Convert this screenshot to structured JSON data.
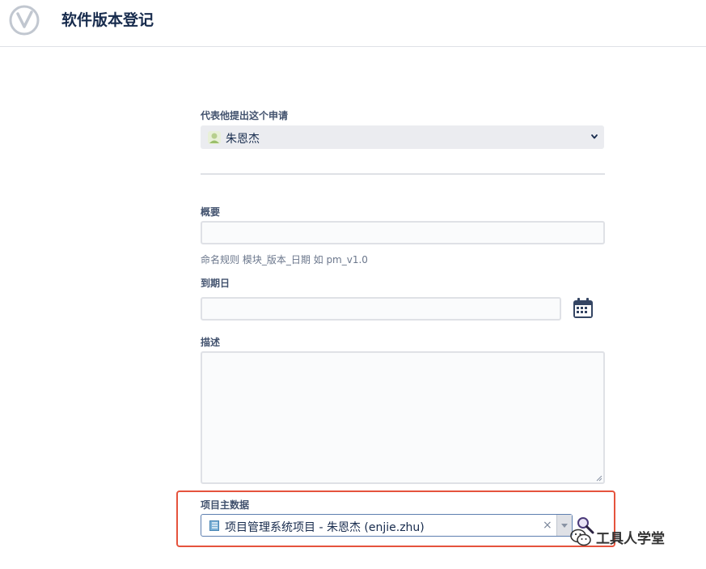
{
  "header": {
    "title": "软件版本登记",
    "logo_icon": "v-logo-icon"
  },
  "form": {
    "on_behalf": {
      "label": "代表他提出这个申请",
      "selected_value": "朱恩杰",
      "avatar_icon": "user-avatar-icon"
    },
    "summary": {
      "label": "概要",
      "value": "",
      "helper": "命名规则 模块_版本_日期 如 pm_v1.0"
    },
    "due_date": {
      "label": "到期日",
      "value": "",
      "calendar_icon": "calendar-icon"
    },
    "description": {
      "label": "描述",
      "value": ""
    },
    "project_master": {
      "label": "项目主数据",
      "selected_value": "项目管理系统项目 - 朱恩杰 (enjie.zhu)",
      "clear_symbol": "×",
      "search_icon": "magnifier-icon"
    }
  },
  "watermark": {
    "text": "工具人学堂",
    "icon": "wechat-icon"
  },
  "colors": {
    "highlight_border": "#e5533d",
    "text_primary": "#172b4d",
    "label": "#42526e"
  }
}
